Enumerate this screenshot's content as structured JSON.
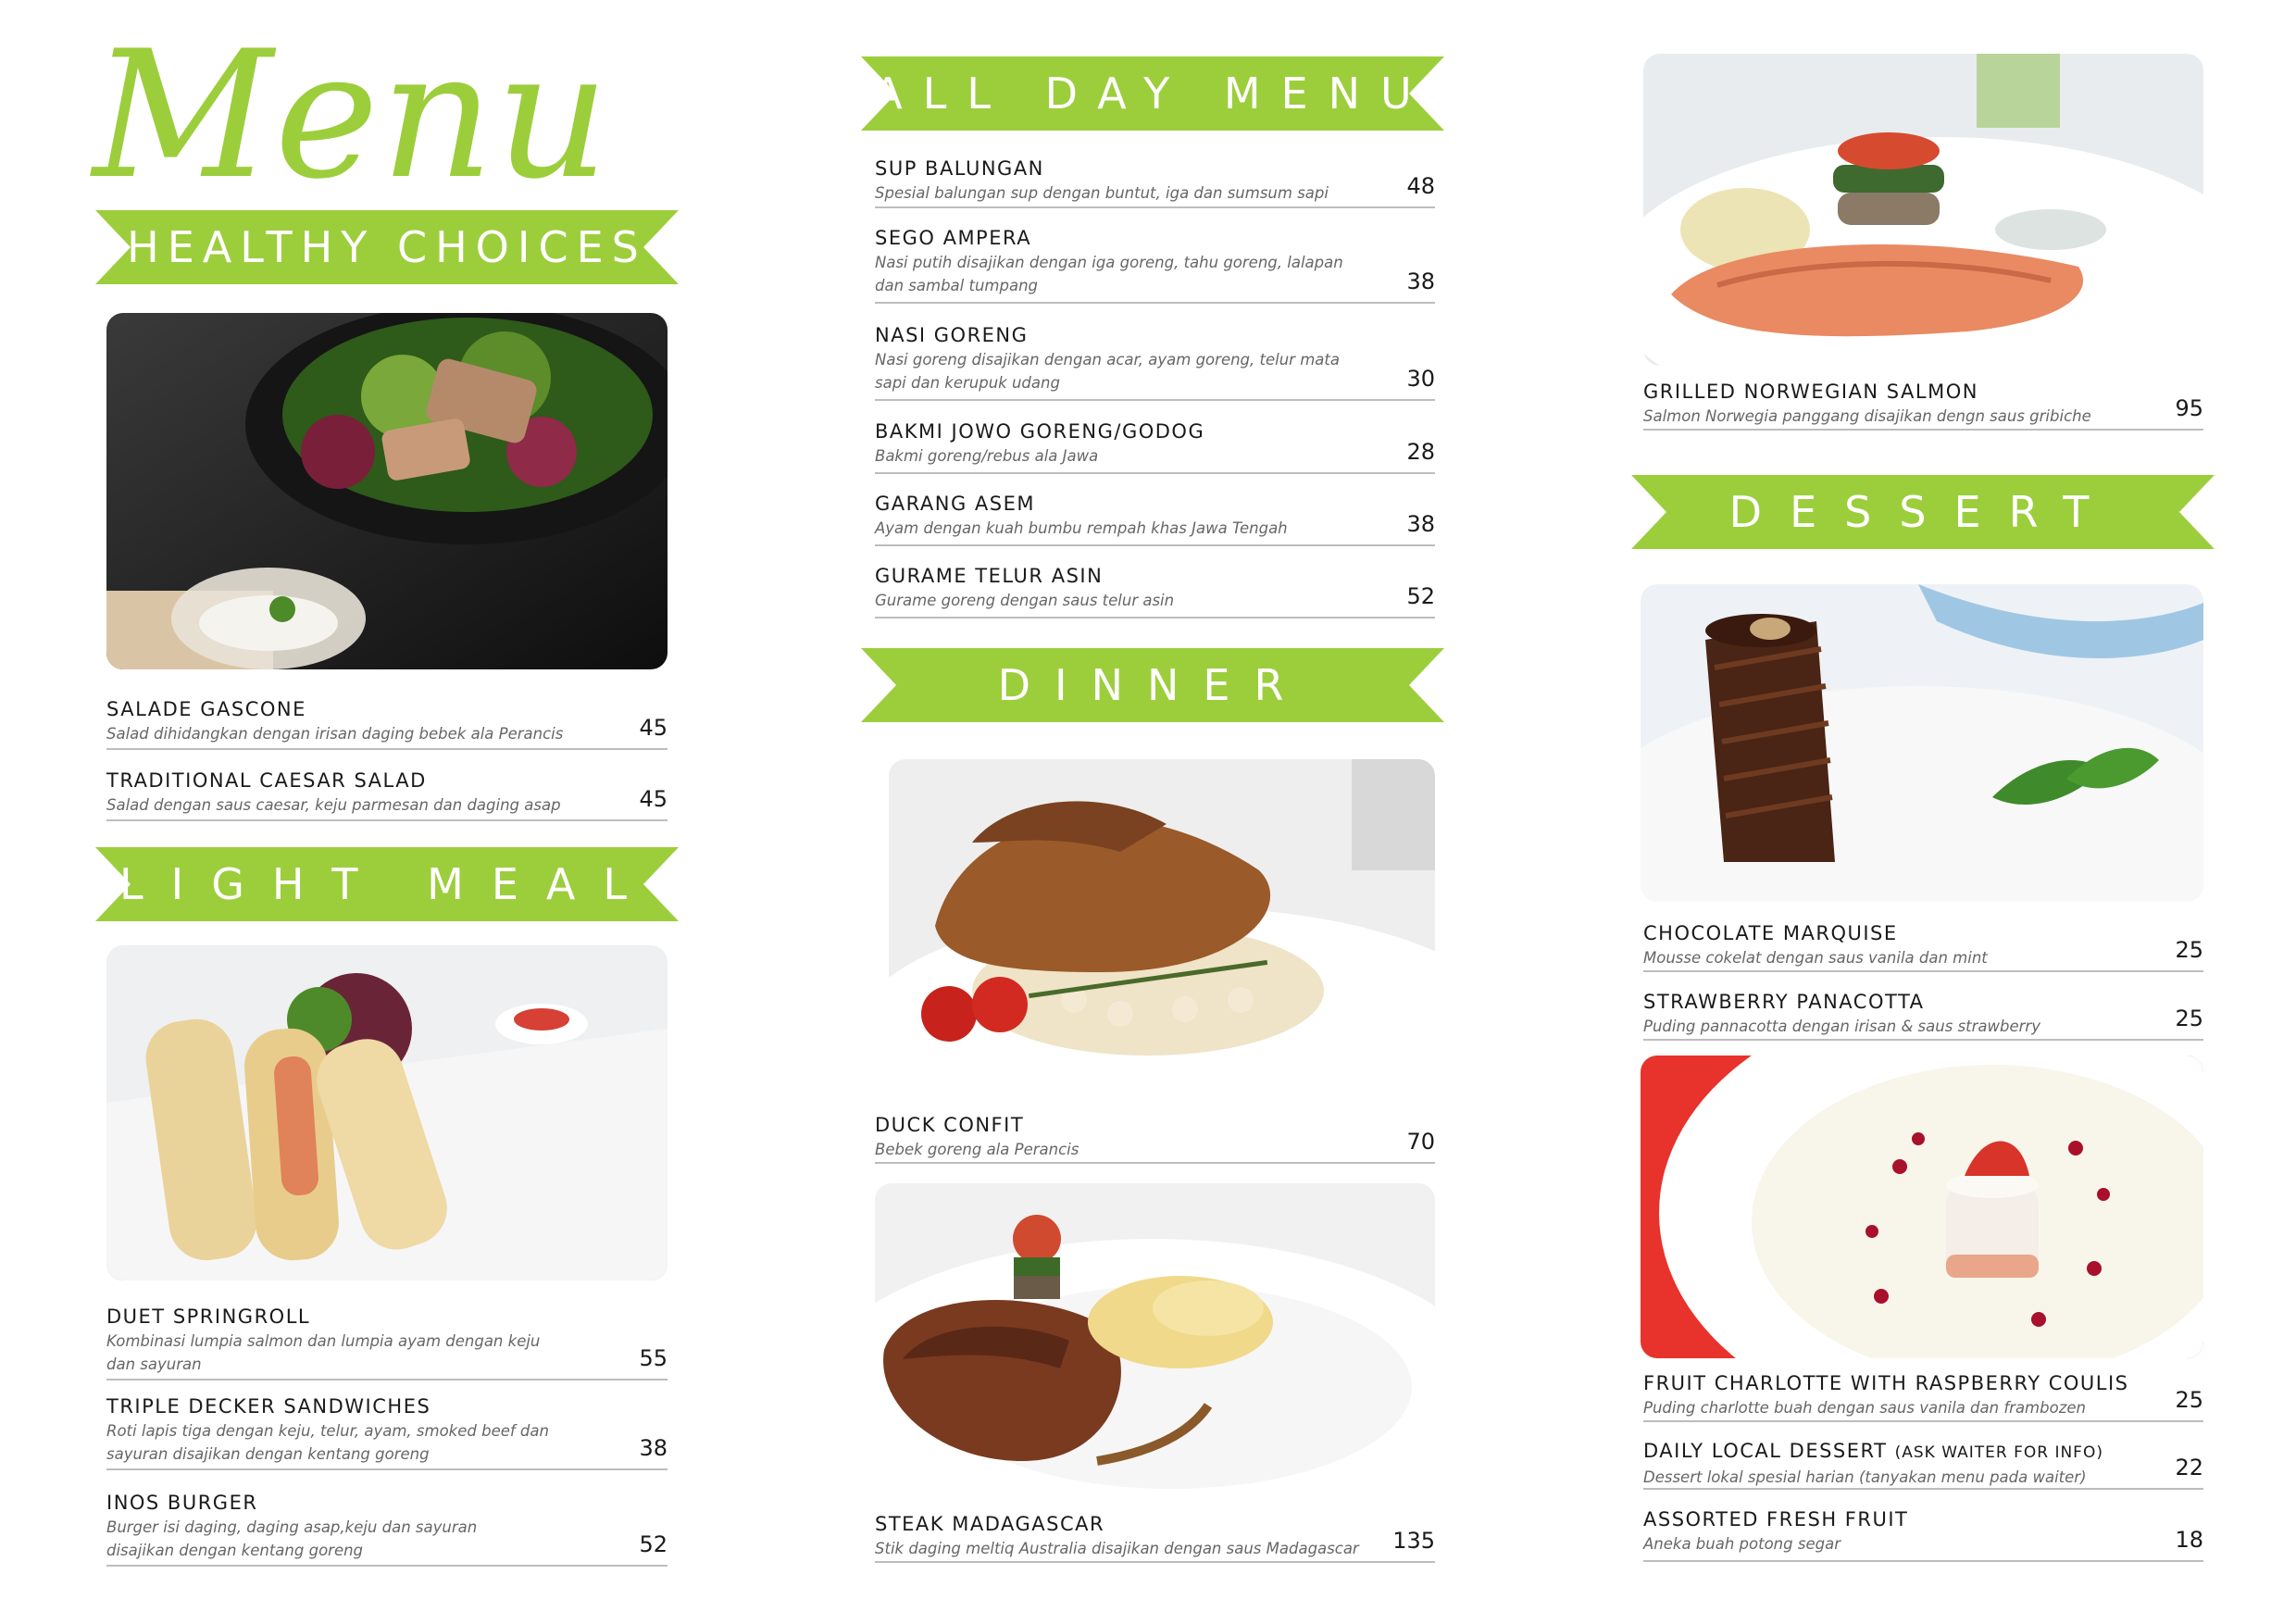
{
  "title": "Menu",
  "colors": {
    "accent": "#9cce3c",
    "rule": "#bdbdbd",
    "text": "#1a1a1a",
    "desc": "#666666"
  },
  "sections": {
    "healthy": "HEALTHY CHOICES",
    "light": "LIGHT MEAL",
    "allday": "ALL DAY MENU",
    "dinner": "DINNER",
    "dessert": "DESSERT"
  },
  "healthy_items": [
    {
      "name": "SALADE GASCONE",
      "desc": "Salad dihidangkan dengan irisan daging bebek ala Perancis",
      "price": "45"
    },
    {
      "name": "TRADITIONAL CAESAR SALAD",
      "desc": "Salad dengan saus caesar, keju parmesan dan daging asap",
      "price": "45"
    }
  ],
  "light_items": [
    {
      "name": "DUET SPRINGROLL",
      "desc1": "Kombinasi lumpia salmon dan lumpia ayam dengan keju",
      "desc2": "dan sayuran",
      "price": "55"
    },
    {
      "name": "TRIPLE DECKER SANDWICHES",
      "desc1": "Roti lapis tiga dengan keju, telur, ayam, smoked beef dan",
      "desc2": "sayuran disajikan dengan kentang goreng",
      "price": "38"
    },
    {
      "name": "INOS BURGER",
      "desc1": "Burger isi daging, daging asap,keju dan sayuran",
      "desc2": "disajikan dengan kentang goreng",
      "price": "52"
    }
  ],
  "allday_items": [
    {
      "name": "SUP BALUNGAN",
      "desc1": "Spesial balungan sup dengan buntut, iga dan sumsum sapi",
      "desc2": "",
      "price": "48"
    },
    {
      "name": "SEGO AMPERA",
      "desc1": "Nasi putih disajikan dengan iga goreng, tahu goreng, lalapan",
      "desc2": "dan sambal tumpang",
      "price": "38"
    },
    {
      "name": "NASI GORENG",
      "desc1": "Nasi goreng disajikan dengan acar, ayam goreng, telur mata",
      "desc2": "sapi dan kerupuk udang",
      "price": "30"
    },
    {
      "name": "BAKMI JOWO GORENG/GODOG",
      "desc1": "Bakmi goreng/rebus ala Jawa",
      "desc2": "",
      "price": "28"
    },
    {
      "name": "GARANG ASEM",
      "desc1": "Ayam dengan kuah bumbu rempah khas Jawa Tengah",
      "desc2": "",
      "price": "38"
    },
    {
      "name": "GURAME TELUR ASIN",
      "desc1": "Gurame goreng dengan saus telur asin",
      "desc2": "",
      "price": "52"
    }
  ],
  "dinner_items": [
    {
      "name": "DUCK CONFIT",
      "desc": "Bebek goreng ala Perancis",
      "price": "70"
    },
    {
      "name": "STEAK MADAGASCAR",
      "desc": "Stik daging meltiq Australia disajikan dengan saus Madagascar",
      "price": "135"
    },
    {
      "name": "GRILLED NORWEGIAN SALMON",
      "desc": "Salmon Norwegia panggang disajikan dengn saus gribiche",
      "price": "95"
    }
  ],
  "dessert_items": [
    {
      "name": "CHOCOLATE MARQUISE",
      "desc": "Mousse cokelat dengan saus vanila dan mint",
      "price": "25"
    },
    {
      "name": "STRAWBERRY PANACOTTA",
      "desc": "Puding pannacotta dengan irisan & saus strawberry",
      "price": "25"
    },
    {
      "name": "FRUIT CHARLOTTE WITH RASPBERRY COULIS",
      "desc": "Puding charlotte buah dengan saus vanila dan frambozen",
      "price": "25"
    },
    {
      "name": "DAILY LOCAL DESSERT",
      "name_note": "(ASK WAITER FOR INFO)",
      "desc": "Dessert lokal spesial harian (tanyakan menu pada waiter)",
      "price": "22"
    },
    {
      "name": "ASSORTED FRESH FRUIT",
      "desc": "Aneka buah potong segar",
      "price": "18"
    }
  ]
}
